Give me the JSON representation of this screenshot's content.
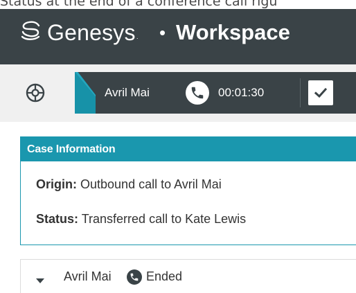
{
  "caption": "Status at the end of a conference call rigu",
  "header": {
    "brand": "Genesys",
    "trademark": "·",
    "separator": "•",
    "product": "Workspace",
    "background": "#3a4347"
  },
  "toolbar": {
    "icon": "support-menu-icon",
    "call_tab": {
      "contact_name": "Avril Mai",
      "call_icon": "phone-icon",
      "timer": "00:01:30",
      "done_icon": "checkmark-icon",
      "accent": "#22a7bf"
    }
  },
  "case_information": {
    "title": "Case Information",
    "accent": "#1a97ae",
    "origin_label": "Origin:",
    "origin_value": "Outbound call to Avril Mai",
    "status_label": "Status:",
    "status_value": "Transferred call to Kate Lewis"
  },
  "interaction": {
    "caret_icon": "caret-down-icon",
    "party": "Avril Mai",
    "status_icon": "phone-icon",
    "status": "Ended"
  }
}
